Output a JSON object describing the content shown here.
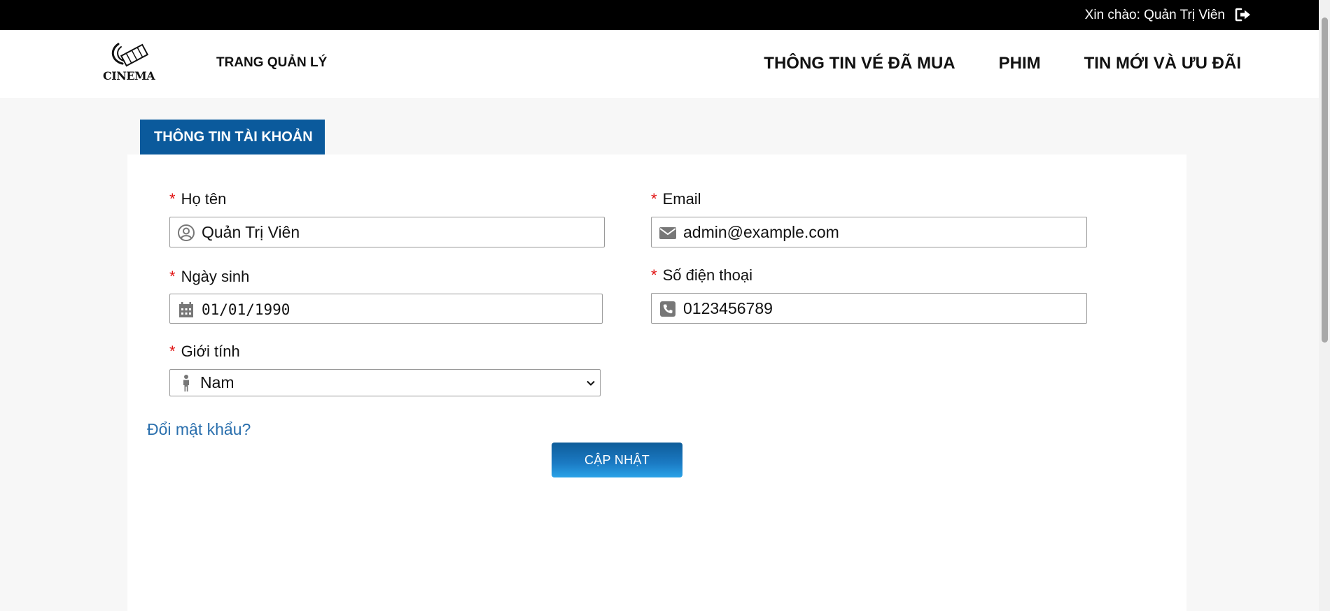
{
  "topbar": {
    "greeting": "Xin chào: Quản Trị Viên",
    "logout_icon": "sign-out-icon"
  },
  "header": {
    "logo_text": "CINEMA",
    "admin_link": "TRANG QUẢN LÝ",
    "nav": [
      {
        "label": "THÔNG TIN VÉ ĐÃ MUA"
      },
      {
        "label": "PHIM"
      },
      {
        "label": "TIN MỚI VÀ ƯU ĐÃI"
      }
    ]
  },
  "tab": {
    "label": "THÔNG TIN TÀI KHOẢN"
  },
  "form": {
    "required_mark": "*",
    "name": {
      "label": "Họ tên",
      "value": "Quản Trị Viên",
      "icon": "user-circle-icon"
    },
    "email": {
      "label": "Email",
      "value": "admin@example.com",
      "icon": "envelope-icon"
    },
    "birthday": {
      "label": "Ngày sinh",
      "value": "01/01/1990",
      "icon": "calendar-icon"
    },
    "phone": {
      "label": "Số điện thoại",
      "value": "0123456789",
      "icon": "phone-square-icon"
    },
    "gender": {
      "label": "Giới tính",
      "value": "Nam",
      "icon": "male-icon"
    },
    "change_password": "Đổi mật khẩu?",
    "submit": "CẬP NHẬT"
  },
  "colors": {
    "topbar": "#000000",
    "tab": "#0b5a9c",
    "required": "#e01010",
    "link": "#2a6fad",
    "button_top": "#0e5c99",
    "button_bottom": "#2aa3e8"
  }
}
